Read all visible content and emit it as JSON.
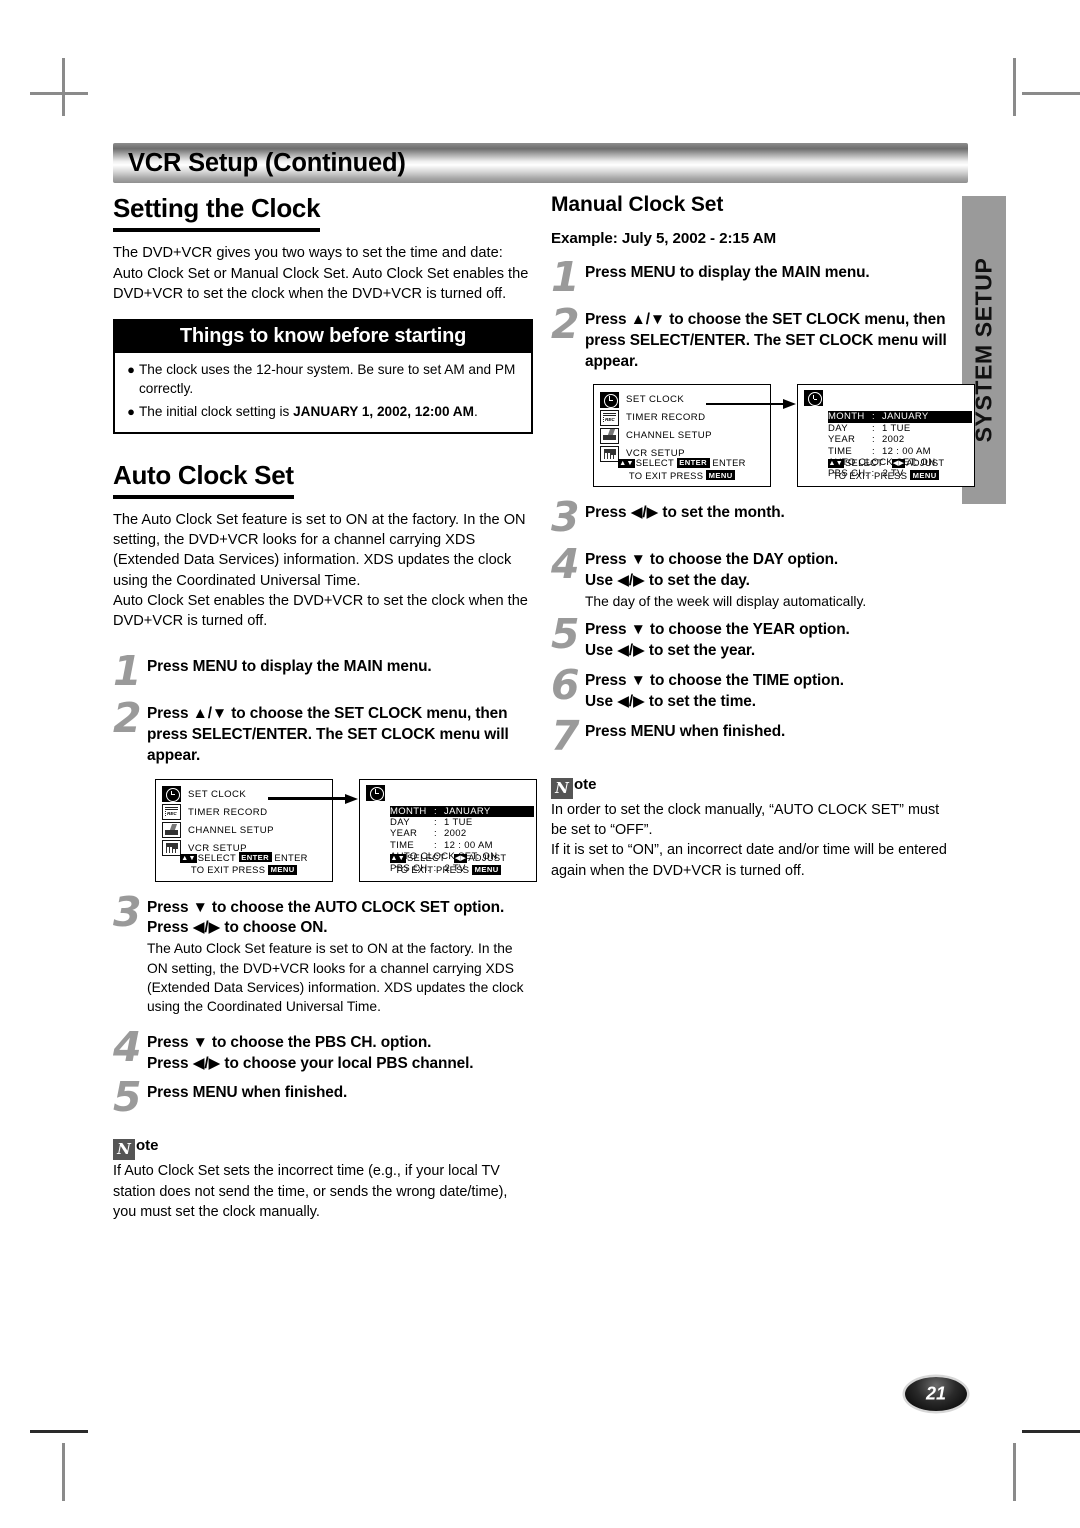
{
  "header": {
    "title": "VCR Setup (Continued)"
  },
  "side_tab": {
    "label": "SYSTEM SETUP"
  },
  "page_number": "21",
  "left": {
    "heading": "Setting the Clock",
    "intro": "The DVD+VCR gives you two ways to set the time and date: Auto Clock Set or Manual Clock Set. Auto Clock Set enables the DVD+VCR to set the clock when the DVD+VCR is turned off.",
    "things_box": {
      "title": "Things to know before starting",
      "items": [
        {
          "text": "The clock uses the 12-hour system. Be sure to set AM and PM correctly.",
          "bold": ""
        },
        {
          "text": "The initial clock setting is ",
          "bold": "JANUARY 1, 2002, 12:00 AM",
          "tail": "."
        }
      ]
    },
    "auto_heading": "Auto Clock Set",
    "auto_intro_1": "The Auto Clock Set feature is set to ON at the factory. In the ON setting, the DVD+VCR looks for a channel carrying XDS (Extended Data Services) information. XDS updates the clock using the Coordinated Universal Time.",
    "auto_intro_2": "Auto Clock Set enables the DVD+VCR to set the clock when the DVD+VCR is turned off.",
    "steps": [
      {
        "num": "1",
        "bold": "Press MENU to display the MAIN menu."
      },
      {
        "num": "2",
        "bold": "Press ▲/▼ to choose the SET CLOCK menu, then press SELECT/ENTER. The SET CLOCK menu will appear."
      },
      {
        "num": "3",
        "bold": "Press ▼ to choose the AUTO CLOCK SET option.",
        "bold2": "Press ◀/▶ to choose ON.",
        "normal": "The Auto Clock Set feature is set to ON at the factory. In the ON setting, the DVD+VCR looks for a channel carrying XDS (Extended Data Services) information. XDS updates the clock using the Coordinated Universal Time."
      },
      {
        "num": "4",
        "bold": "Press ▼ to choose the PBS CH. option.",
        "bold2": "Press ◀/▶ to choose your local PBS channel."
      },
      {
        "num": "5",
        "bold": "Press MENU when finished."
      }
    ],
    "note": {
      "badge": "N",
      "label": "ote",
      "text": "If Auto Clock Set sets the incorrect time (e.g., if your local TV station does not send the time, or sends the wrong date/time), you must set the clock manually."
    }
  },
  "right": {
    "heading": "Manual Clock Set",
    "example": "Example: July 5, 2002 - 2:15 AM",
    "steps": [
      {
        "num": "1",
        "bold": "Press MENU to display the MAIN menu."
      },
      {
        "num": "2",
        "bold": "Press ▲/▼ to choose the SET CLOCK menu, then press SELECT/ENTER. The SET CLOCK menu will appear."
      },
      {
        "num": "3",
        "bold": "Press ◀/▶ to set the month."
      },
      {
        "num": "4",
        "bold": "Press ▼ to choose the DAY option.",
        "bold2": "Use ◀/▶ to set the day.",
        "normal": "The day of the week will display automatically."
      },
      {
        "num": "5",
        "bold": "Press ▼ to choose the YEAR option.",
        "bold2": "Use ◀/▶ to set the year."
      },
      {
        "num": "6",
        "bold": "Press ▼ to choose the TIME option.",
        "bold2": "Use ◀/▶ to set the time."
      },
      {
        "num": "7",
        "bold": "Press MENU when finished."
      }
    ],
    "note": {
      "badge": "N",
      "label": "ote",
      "text_1": "In order to set the clock manually, “AUTO CLOCK SET” must be set to “OFF”.",
      "text_2": "If it is set to “ON”, an incorrect date and/or time will be entered again when the DVD+VCR is turned off."
    }
  },
  "osd": {
    "main_menu": {
      "items": [
        {
          "label": "SET  CLOCK",
          "icon": "clock-icon",
          "selected": true
        },
        {
          "label": "TIMER RECORD",
          "icon": "timer-record-icon",
          "selected": false
        },
        {
          "label": "CHANNEL  SETUP",
          "icon": "channel-setup-icon",
          "selected": false
        },
        {
          "label": "VCR SETUP",
          "icon": "vcr-setup-icon",
          "selected": false
        }
      ],
      "footer_line1_a": "SELECT",
      "footer_line1_key": "ENTER",
      "footer_line1_b": "ENTER",
      "footer_line2_a": "TO  EXIT   PRESS",
      "footer_line2_key": "MENU"
    },
    "clock_menu": {
      "rows": [
        {
          "key": "MONTH",
          "colon": ":",
          "value": "JANUARY",
          "highlight": true
        },
        {
          "key": "DAY",
          "colon": ":",
          "value": "1   TUE",
          "highlight": false
        },
        {
          "key": "YEAR",
          "colon": ":",
          "value": "2002",
          "highlight": false
        },
        {
          "key": "TIME",
          "colon": ":",
          "value": "12 : 00  AM",
          "highlight": false
        },
        {
          "key": "AUTO CLOCK SET: ON",
          "colon": "",
          "value": "",
          "highlight": false,
          "wide": true
        },
        {
          "key": "PBS CH. :",
          "colon": "",
          "value": "2        TV",
          "highlight": false,
          "wide": true
        }
      ],
      "footer_line1_a": "SELECT",
      "footer_line1_b": "ADJUST",
      "footer_line2_a": "TO  EXIT   PRESS",
      "footer_line2_key": "MENU"
    }
  }
}
